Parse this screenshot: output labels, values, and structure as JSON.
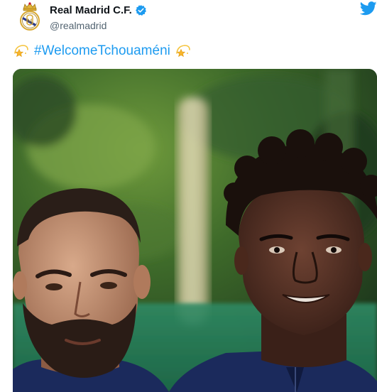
{
  "account": {
    "display_name": "Real Madrid C.F.",
    "handle": "@realmadrid",
    "verified": true,
    "avatar_icon": "real-madrid-crest-icon"
  },
  "tweet": {
    "hashtag": "#WelcomeTchouaméni",
    "leading_icon": "dizzy-star-emoji-icon",
    "trailing_icon": "dizzy-star-emoji-icon"
  },
  "brand": {
    "twitter_icon": "twitter-bird-icon",
    "accent_color": "#1d9bf0"
  },
  "media": {
    "kind": "photo",
    "subject": "two-football-players-portrait"
  }
}
